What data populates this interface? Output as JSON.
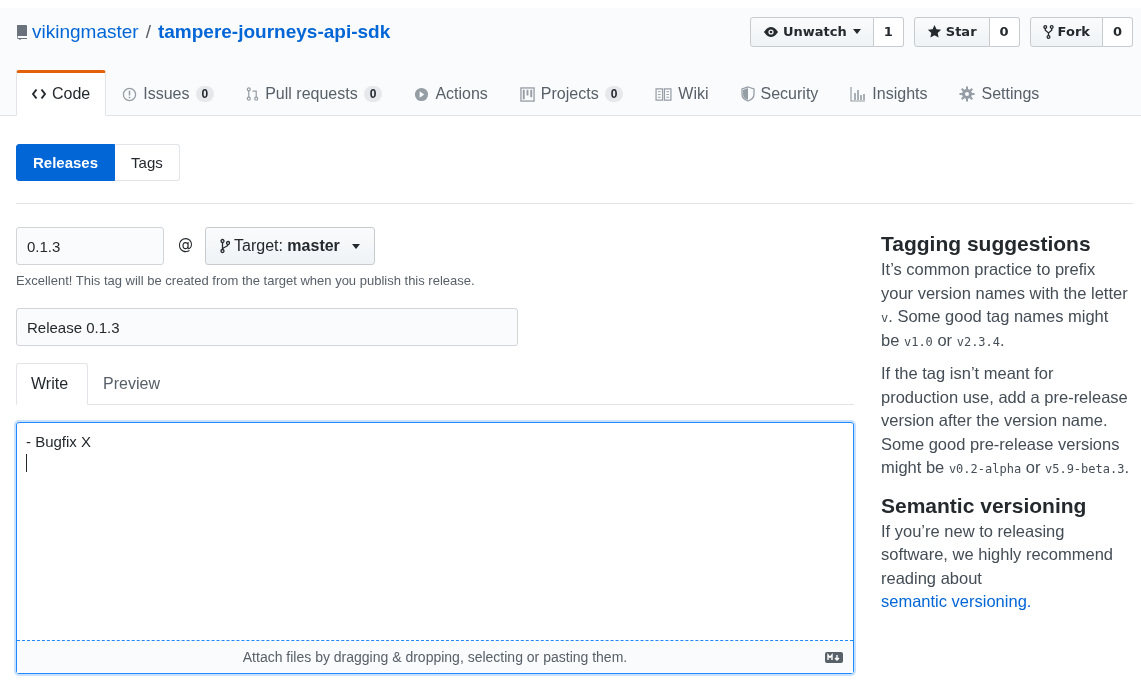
{
  "repo": {
    "owner": "vikingmaster",
    "separator": "/",
    "name": "tampere-journeys-api-sdk"
  },
  "actions": [
    {
      "label": "Unwatch",
      "count": "1",
      "dropdown": true
    },
    {
      "label": "Star",
      "count": "0",
      "dropdown": false
    },
    {
      "label": "Fork",
      "count": "0",
      "dropdown": false
    }
  ],
  "tabs": [
    {
      "label": "Code",
      "selected": true
    },
    {
      "label": "Issues",
      "count": "0",
      "selected": false
    },
    {
      "label": "Pull requests",
      "count": "0",
      "selected": false
    },
    {
      "label": "Actions",
      "selected": false
    },
    {
      "label": "Projects",
      "count": "0",
      "selected": false
    },
    {
      "label": "Wiki",
      "selected": false
    },
    {
      "label": "Security",
      "selected": false
    },
    {
      "label": "Insights",
      "selected": false
    },
    {
      "label": "Settings",
      "selected": false
    }
  ],
  "subnav": [
    {
      "label": "Releases",
      "selected": true
    },
    {
      "label": "Tags",
      "selected": false
    }
  ],
  "form": {
    "tag_value": "0.1.3",
    "at": "@",
    "target_label": "Target:",
    "target_branch": "master",
    "hint": "Excellent! This tag will be created from the target when you publish this release.",
    "title_value": "Release 0.1.3",
    "editor_tabs": [
      {
        "label": "Write",
        "selected": true
      },
      {
        "label": "Preview",
        "selected": false
      }
    ],
    "body_value": "- Bugfix X",
    "attach_text": "Attach files by dragging & dropping, selecting or pasting them."
  },
  "sidebar": [
    {
      "heading": "Tagging suggestions",
      "paragraphs": [
        [
          {
            "kind": "text",
            "text": "It’s common practice to prefix your version names with the letter "
          },
          {
            "kind": "code",
            "text": "v"
          },
          {
            "kind": "text",
            "text": ". Some good tag names might be "
          },
          {
            "kind": "code",
            "text": "v1.0"
          },
          {
            "kind": "text",
            "text": " or "
          },
          {
            "kind": "code",
            "text": "v2.3.4"
          },
          {
            "kind": "text",
            "text": "."
          }
        ],
        [
          {
            "kind": "text",
            "text": "If the tag isn’t meant for production use, add a pre-release version after the version name. Some good pre-release versions might be "
          },
          {
            "kind": "code",
            "text": "v0.2-alpha"
          },
          {
            "kind": "text",
            "text": " or "
          },
          {
            "kind": "code",
            "text": "v5.9-beta.3"
          },
          {
            "kind": "text",
            "text": "."
          }
        ]
      ]
    },
    {
      "heading": "Semantic versioning",
      "paragraphs": [
        [
          {
            "kind": "text",
            "text": "If you’re new to releasing software, we highly recommend reading about "
          },
          {
            "kind": "link",
            "text": "semantic versioning."
          }
        ]
      ]
    }
  ]
}
